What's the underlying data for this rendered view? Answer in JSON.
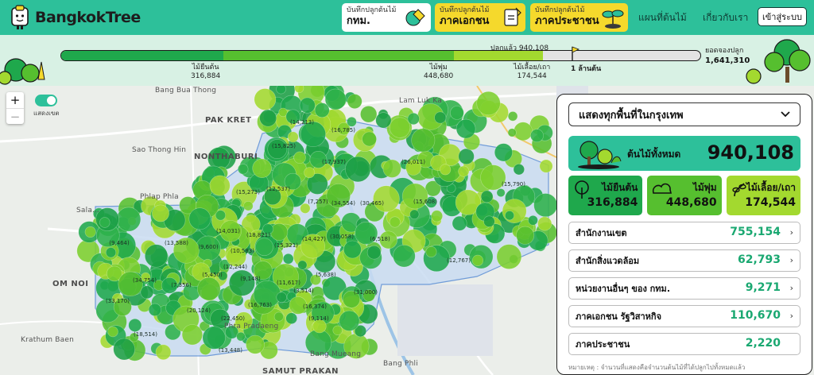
{
  "header": {
    "logo_text": "BangkokTree",
    "record_cards": [
      {
        "sub": "บันทึกปลูกต้นไม้",
        "main": "กทม."
      },
      {
        "sub": "บันทึกปลูกต้นไม้",
        "main": "ภาคเอกชน"
      },
      {
        "sub": "บันทึกปลูกต้นไม้",
        "main": "ภาคประชาชน"
      }
    ],
    "nav": [
      "แผนที่ต้นไม้",
      "เกี่ยวกับเรา"
    ],
    "login_label": "เข้าสู่ระบบ"
  },
  "progress": {
    "caption": "ปลูกแล้ว 940,108",
    "goal_label": "1 ล้านต้น",
    "goal_value": 1000000,
    "segments": [
      {
        "label": "ไม้ยืนต้น",
        "value_text": "316,884",
        "value": 316884,
        "color": "#1fa84c"
      },
      {
        "label": "ไม้พุ่ม",
        "value_text": "448,680",
        "value": 448680,
        "color": "#56bf2f"
      },
      {
        "label": "ไม้เลื้อย/เถา",
        "value_text": "174,544",
        "value": 174544,
        "color": "#a3d92f"
      }
    ],
    "total_label": "ยอดจองปลูก",
    "total_value": "1,641,310"
  },
  "map": {
    "toggle_label": "แสดงเขต",
    "zoom_in": "+",
    "zoom_out": "−",
    "places": [
      "Bang Bua Thong",
      "PAK KRET",
      "Lam Luk Ka",
      "Sao Thong Hin",
      "NONTHABURI",
      "Phlap Phla",
      "Sala...",
      "OM NOI",
      "Krathum Baen",
      "Phra Pradaeng",
      "Bang Mueang",
      "Bang Phli",
      "SAMUT PRAKAN"
    ],
    "district_counts": [
      "14,213",
      "16,785",
      "15,825",
      "17,937",
      "26,011",
      "15,273",
      "12,537",
      "7,257",
      "34,554",
      "30,465",
      "15,608",
      "15,790",
      "9,464",
      "13,588",
      "18,821",
      "14,031",
      "10,583",
      "9,600",
      "15,321",
      "14,427",
      "30,058",
      "6,518",
      "34,754",
      "5,450",
      "9,148",
      "11,617",
      "12,244",
      "7,356",
      "16,763",
      "3,514",
      "5,638",
      "33,170",
      "20,124",
      "22,450",
      "16,374",
      "9,114",
      "12,767",
      "18,514",
      "13,448",
      "31,000"
    ]
  },
  "panel": {
    "area_select": "แสดงทุกพื้นที่ในกรุงเทพ",
    "total_label": "ต้นไม้ทั้งหมด",
    "total_value": "940,108",
    "categories": [
      {
        "label": "ไม้ยืนต้น",
        "value": "316,884"
      },
      {
        "label": "ไม้พุ่ม",
        "value": "448,680"
      },
      {
        "label": "ไม้เลื้อย/เถา",
        "value": "174,544"
      }
    ],
    "sources": [
      {
        "name": "สำนักงานเขต",
        "value": "755,154",
        "chevron": "›"
      },
      {
        "name": "สำนักสิ่งแวดล้อม",
        "value": "62,793",
        "chevron": "›"
      },
      {
        "name": "หน่วยงานอื่นๆ ของ กทม.",
        "value": "9,271",
        "chevron": "›"
      },
      {
        "name": "ภาคเอกชน รัฐวิสาหกิจ",
        "value": "110,670",
        "chevron": "›"
      },
      {
        "name": "ภาคประชาชน",
        "value": "2,220",
        "chevron": ""
      }
    ],
    "note": "หมายเหตุ : จำนวนที่แสดงคือจำนวนต้นไม้ที่ได้ปลูกไปทั้งหมดแล้ว"
  },
  "colors": {
    "brand": "#2dc09a",
    "accent_yellow": "#f5d92c",
    "tree": "#1fa84c",
    "shrub": "#56bf2f",
    "vine": "#a3d92f",
    "value_green": "#1aa871"
  },
  "icons": {
    "mascot": "tree-mascot-icon",
    "flag": "goal-flag-icon",
    "chevron": "chevron-down-icon"
  }
}
